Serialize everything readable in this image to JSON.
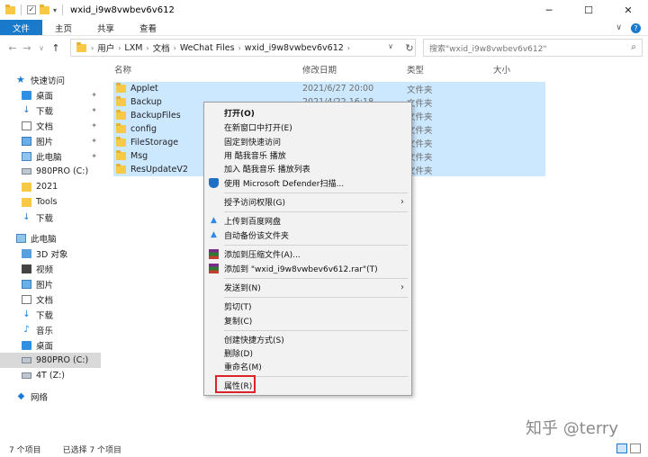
{
  "window": {
    "title": "wxid_i9w8vwbev6v612",
    "minimize_glyph": "─",
    "maximize_glyph": "☐",
    "close_glyph": "✕"
  },
  "ribbon": {
    "tabs": [
      "文件",
      "主页",
      "共享",
      "查看"
    ],
    "collapse_glyph": "∨",
    "help_glyph": "?"
  },
  "nav": {
    "back": "←",
    "forward": "→",
    "recent": "∨",
    "up": "↑",
    "breadcrumb": [
      "用户",
      "LXM",
      "文档",
      "WeChat Files",
      "wxid_i9w8vwbev6v612"
    ],
    "breadcrumb_sep": "›",
    "dropdown_glyph": "∨",
    "refresh": "↻",
    "search_placeholder": "搜索\"wxid_i9w8vwbev6v612\"",
    "search_glyph": "⌕"
  },
  "sidebar": {
    "items": [
      {
        "label": "快速访问",
        "icon": "star-icon",
        "pinned": false
      },
      {
        "label": "桌面",
        "icon": "desktop-icon",
        "pinned": true
      },
      {
        "label": "下载",
        "icon": "download-icon",
        "pinned": true
      },
      {
        "label": "文档",
        "icon": "document-icon",
        "pinned": true
      },
      {
        "label": "图片",
        "icon": "pictures-icon",
        "pinned": true
      },
      {
        "label": "此电脑",
        "icon": "computer-icon",
        "pinned": true
      },
      {
        "label": "980PRO (C:)",
        "icon": "drive-icon",
        "pinned": true
      },
      {
        "label": "2021",
        "icon": "folder-icon",
        "pinned": false
      },
      {
        "label": "Tools",
        "icon": "folder-icon",
        "pinned": false
      },
      {
        "label": "下载",
        "icon": "download-icon",
        "pinned": false
      },
      {
        "label": "此电脑",
        "icon": "computer-icon",
        "pinned": false
      },
      {
        "label": "3D 对象",
        "icon": "3d-objects-icon",
        "pinned": false
      },
      {
        "label": "视频",
        "icon": "video-icon",
        "pinned": false
      },
      {
        "label": "图片",
        "icon": "pictures-icon",
        "pinned": false
      },
      {
        "label": "文档",
        "icon": "document-icon",
        "pinned": false
      },
      {
        "label": "下载",
        "icon": "download-icon",
        "pinned": false
      },
      {
        "label": "音乐",
        "icon": "music-icon",
        "pinned": false
      },
      {
        "label": "桌面",
        "icon": "desktop-icon",
        "pinned": false
      },
      {
        "label": "980PRO (C:)",
        "icon": "drive-icon",
        "pinned": false,
        "active": true
      },
      {
        "label": "4T (Z:)",
        "icon": "drive-icon",
        "pinned": false
      },
      {
        "label": "网络",
        "icon": "network-icon",
        "pinned": false
      }
    ],
    "pin_glyph": "📌"
  },
  "columns": {
    "name": "名称",
    "date": "修改日期",
    "type": "类型",
    "size": "大小"
  },
  "files": [
    {
      "name": "Applet",
      "date": "2021/6/27 20:00",
      "type": "文件夹"
    },
    {
      "name": "Backup",
      "date": "2021/4/22 16:18",
      "type": "文件夹"
    },
    {
      "name": "BackupFiles",
      "date": "",
      "type": "文件夹"
    },
    {
      "name": "config",
      "date": "",
      "type": "文件夹"
    },
    {
      "name": "FileStorage",
      "date": "",
      "type": "文件夹"
    },
    {
      "name": "Msg",
      "date": "",
      "type": "文件夹"
    },
    {
      "name": "ResUpdateV2",
      "date": "",
      "type": "文件夹"
    }
  ],
  "context_menu": {
    "open": "打开(O)",
    "open_new_window": "在新窗口中打开(E)",
    "pin_quick_access": "固定到快速访问",
    "play_kuwo": "用 酷我音乐 播放",
    "add_kuwo_list": "加入 酷我音乐 播放列表",
    "defender_scan": "使用 Microsoft Defender扫描...",
    "grant_access": "授予访问权限(G)",
    "upload_baidu": "上传到百度网盘",
    "auto_backup": "自动备份该文件夹",
    "add_archive": "添加到压缩文件(A)...",
    "add_rar": "添加到 \"wxid_i9w8vwbev6v612.rar\"(T)",
    "send_to": "发送到(N)",
    "cut": "剪切(T)",
    "copy": "复制(C)",
    "create_shortcut": "创建快捷方式(S)",
    "delete": "删除(D)",
    "rename": "重命名(M)",
    "properties": "属性(R)",
    "submenu_glyph": "›"
  },
  "status": {
    "count": "7 个项目",
    "selected": "已选择 7 个项目"
  },
  "watermark": "知乎 @terry"
}
